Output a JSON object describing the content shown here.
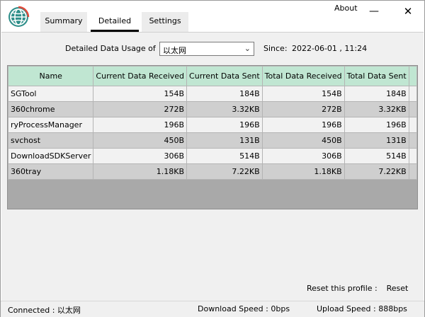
{
  "app": {
    "about": "About",
    "minimize_glyph": "—",
    "close_glyph": "✕",
    "logo_icon": "globe-icon"
  },
  "tabs": [
    {
      "label": "Summary"
    },
    {
      "label": "Detailed",
      "active": true
    },
    {
      "label": "Settings"
    }
  ],
  "detailed": {
    "usage_label": "Detailed Data Usage of",
    "adapter_selected": "以太网",
    "since_label": "Since:",
    "since_value": "2022-06-01 , 11:24",
    "columns": [
      "Name",
      "Current Data Received",
      "Current Data Sent",
      "Total Data Received",
      "Total Data Sent"
    ],
    "rows": [
      [
        "SGTool",
        "154B",
        "184B",
        "154B",
        "184B"
      ],
      [
        "360chrome",
        "272B",
        "3.32KB",
        "272B",
        "3.32KB"
      ],
      [
        "ryProcessManager",
        "196B",
        "196B",
        "196B",
        "196B"
      ],
      [
        "svchost",
        "450B",
        "131B",
        "450B",
        "131B"
      ],
      [
        "DownloadSDKServer",
        "306B",
        "514B",
        "306B",
        "514B"
      ],
      [
        "360tray",
        "1.18KB",
        "7.22KB",
        "1.18KB",
        "7.22KB"
      ]
    ],
    "reset_label": "Reset this profile :",
    "reset_button": "Reset"
  },
  "status": {
    "connected": "Connected : 以太网",
    "download": "Download Speed : 0bps",
    "upload": "Upload Speed : 888bps"
  },
  "colors": {
    "header_bg": "#c0e6d2",
    "row_light": "#f2f2f2",
    "row_dark": "#cfcfcf"
  }
}
